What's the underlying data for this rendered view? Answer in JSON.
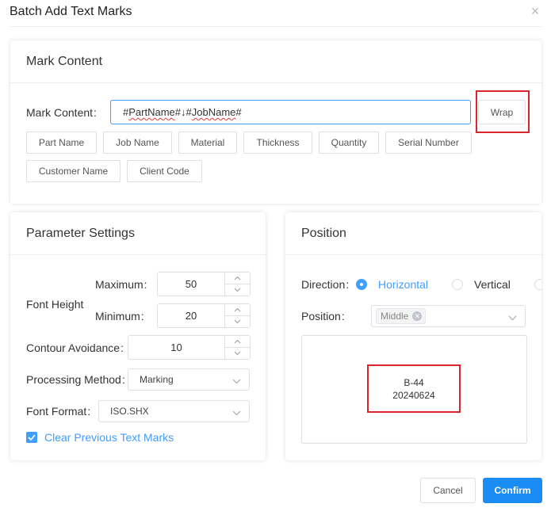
{
  "dialog": {
    "title": "Batch Add Text Marks"
  },
  "mark_content": {
    "heading": "Mark Content",
    "label": "Mark Content",
    "input_value": {
      "part1": "#",
      "part2": "PartName",
      "part3": "#↓#",
      "part4": "JobName",
      "part5": "#"
    },
    "wrap_label": "Wrap",
    "chips": [
      "Part Name",
      "Job Name",
      "Material",
      "Thickness",
      "Quantity",
      "Serial Number",
      "Customer Name",
      "Client Code"
    ]
  },
  "parameters": {
    "heading": "Parameter Settings",
    "font_height_label": "Font Height",
    "maximum_label": "Maximum",
    "maximum_value": "50",
    "minimum_label": "Minimum",
    "minimum_value": "20",
    "contour_label": "Contour Avoidance",
    "contour_value": "10",
    "processing_label": "Processing Method",
    "processing_value": "Marking",
    "font_format_label": "Font Format",
    "font_format_value": "ISO.SHX",
    "clear_marks_label": "Clear Previous Text Marks",
    "clear_marks_checked": true
  },
  "position": {
    "heading": "Position",
    "direction_label": "Direction",
    "horizontal_label": "Horizontal",
    "vertical_label": "Vertical",
    "selected_direction": "Horizontal",
    "position_label": "Position",
    "position_tag": "Middle",
    "preview_line1": "B-44",
    "preview_line2": "20240624"
  },
  "footer": {
    "cancel_label": "Cancel",
    "confirm_label": "Confirm"
  },
  "colors": {
    "accent": "#409eff",
    "confirm": "#1b8cf3",
    "highlight_box": "#d9262e"
  }
}
